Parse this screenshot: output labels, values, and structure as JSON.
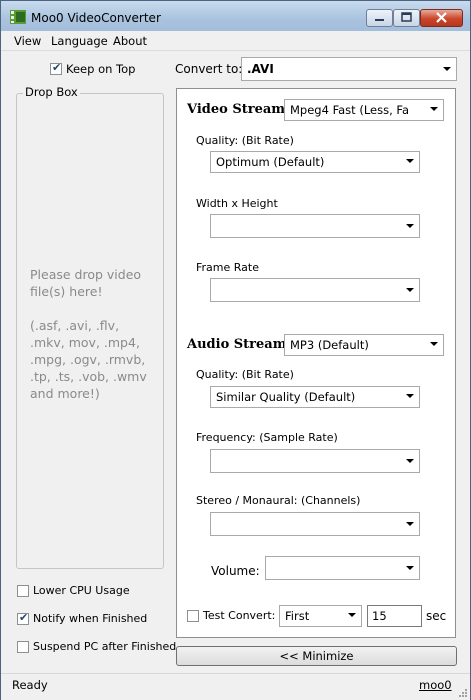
{
  "window": {
    "title": "Moo0 VideoConverter"
  },
  "menu": {
    "view": "View",
    "language": "Language",
    "about": "About"
  },
  "keep_on_top": {
    "label": "Keep on Top",
    "checked": true
  },
  "drop_box": {
    "title": "Drop Box",
    "text": "Please drop video file(s) here!",
    "formats": "(.asf, .avi, .flv, .mkv, mov, .mp4, .mpg, .ogv, .rmvb, .tp, .ts, .vob, .wmv and more!)"
  },
  "options": {
    "lower_cpu": {
      "label": "Lower CPU Usage",
      "checked": false
    },
    "notify": {
      "label": "Notify when Finished",
      "checked": true
    },
    "suspend": {
      "label": "Suspend PC after Finished",
      "checked": false
    }
  },
  "convert_to": {
    "label": "Convert to:",
    "value": ".AVI"
  },
  "video": {
    "title": "Video Stream:",
    "codec": "Mpeg4  Fast     (Less,   Fa",
    "quality_label": "Quality:  (Bit Rate)",
    "quality_value": "Optimum  (Default)",
    "size_label": "Width x Height",
    "size_value": "",
    "framerate_label": "Frame Rate",
    "framerate_value": ""
  },
  "audio": {
    "title": "Audio Stream:",
    "codec": "MP3   (Default)",
    "quality_label": "Quality:  (Bit Rate)",
    "quality_value": "Similar Quality  (Default)",
    "frequency_label": "Frequency:  (Sample Rate)",
    "frequency_value": "",
    "channels_label": "Stereo / Monaural:  (Channels)",
    "channels_value": "",
    "volume_label": "Volume:",
    "volume_value": ""
  },
  "test_convert": {
    "label": "Test Convert:",
    "checked": false,
    "position": "First",
    "seconds": "15",
    "unit": "sec"
  },
  "minimize_button": "<< Minimize",
  "status": {
    "text": "Ready",
    "link": "moo0"
  }
}
